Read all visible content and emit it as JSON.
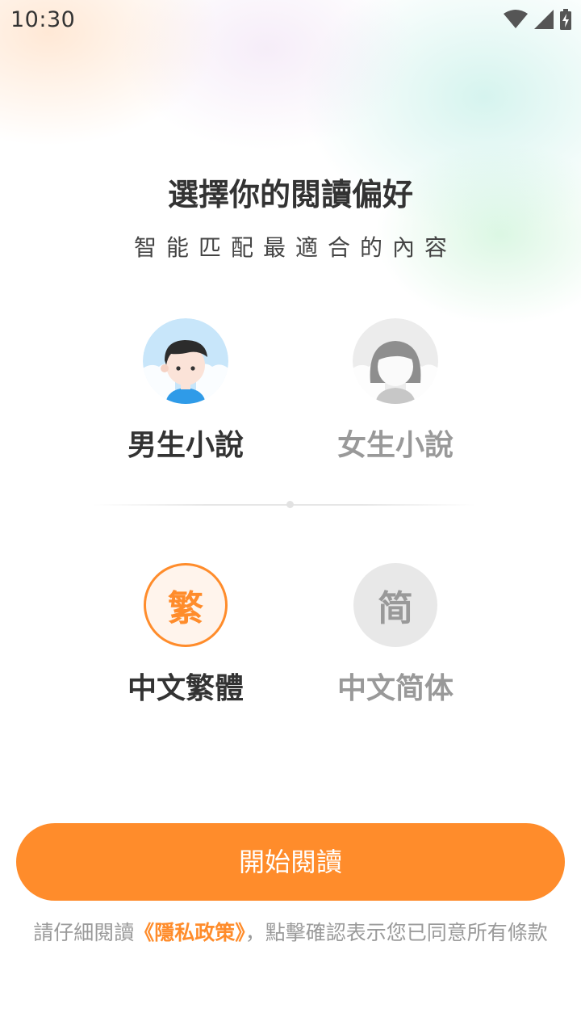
{
  "status_bar": {
    "time": "10:30",
    "icons": [
      "wifi-icon",
      "cellular-signal-icon",
      "battery-charging-icon"
    ]
  },
  "header": {
    "title": "選擇你的閱讀偏好",
    "subtitle": "智能匹配最適合的內容"
  },
  "gender": {
    "options": [
      {
        "label": "男生小說",
        "icon": "boy-avatar-icon",
        "selected": true
      },
      {
        "label": "女生小說",
        "icon": "girl-avatar-icon",
        "selected": false
      }
    ]
  },
  "language": {
    "options": [
      {
        "glyph": "繁",
        "label": "中文繁體",
        "selected": true
      },
      {
        "glyph": "简",
        "label": "中文简体",
        "selected": false
      }
    ]
  },
  "start_button": {
    "label": "開始閱讀"
  },
  "notice": {
    "prefix": "請仔細閱讀",
    "policy_link": "《隱私政策》",
    "suffix": "，點擊確認表示您已同意所有條款"
  },
  "colors": {
    "accent": "#ff8c2b",
    "selected_text": "#333333",
    "unselected_text": "#999999",
    "boy_avatar_bg": "#c8e6fa",
    "unselected_circle_bg": "#e8e8e8"
  }
}
